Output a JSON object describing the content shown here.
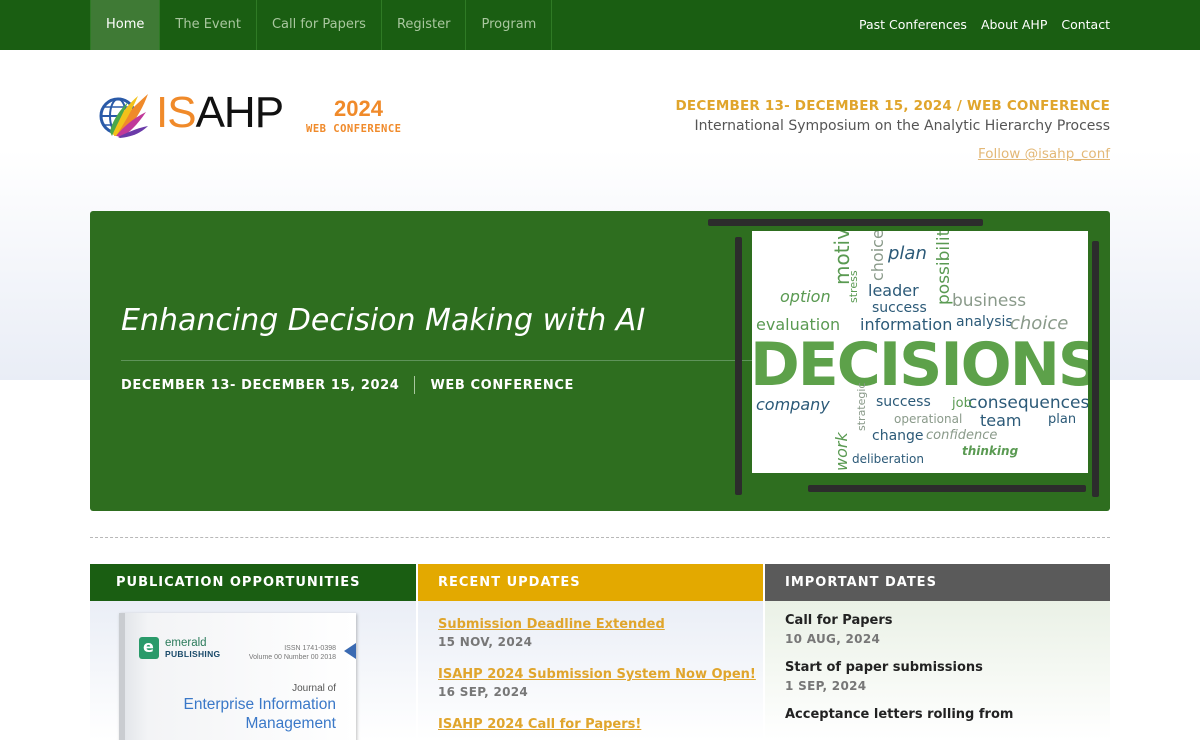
{
  "nav": {
    "items": [
      {
        "label": "Home",
        "active": true
      },
      {
        "label": "The Event"
      },
      {
        "label": "Call for Papers"
      },
      {
        "label": "Register"
      },
      {
        "label": "Program"
      }
    ],
    "right": [
      "Past Conferences",
      "About AHP",
      "Contact"
    ]
  },
  "logo": {
    "is": "IS",
    "ahp": "AHP",
    "year": "2024",
    "sub": "WEB CONFERENCE"
  },
  "header": {
    "dates": "DECEMBER 13- DECEMBER 15, 2024 / WEB CONFERENCE",
    "name": "International Symposium on the Analytic Hierarchy Process",
    "follow": "Follow @isahp_conf"
  },
  "hero": {
    "title": "Enhancing Decision Making with AI",
    "dates": "DECEMBER 13- DECEMBER 15, 2024",
    "format": "WEB CONFERENCE",
    "image_words": {
      "big": "DECISIONS",
      "plan": "plan",
      "possibility": "possibility",
      "business": "business",
      "choice": "choice",
      "option": "option",
      "leader": "leader",
      "success": "success",
      "information": "information",
      "analysis": "analysis",
      "evaluation": "evaluation",
      "confidence": "confidence",
      "stress": "stress",
      "motivation": "motivat",
      "change": "change",
      "company": "company",
      "consequences": "consequences",
      "team": "team",
      "operational": "operational",
      "deliberation": "deliberation",
      "thinking": "thinking",
      "strategic": "strategic",
      "work": "work",
      "job": "job"
    }
  },
  "columns": {
    "publication": {
      "heading": "PUBLICATION OPPORTUNITIES",
      "cover": {
        "publisher_line1": "emerald",
        "publisher_line2": "PUBLISHING",
        "issn": "ISSN 1741-0398",
        "volume": "Volume 00 Number 00 2018",
        "journal_of": "Journal of",
        "title": "Enterprise Information Management"
      }
    },
    "updates": {
      "heading": "RECENT UPDATES",
      "items": [
        {
          "title": "Submission Deadline Extended",
          "date": "15 NOV, 2024"
        },
        {
          "title": "ISAHP 2024 Submission System Now Open!",
          "date": "16 SEP, 2024"
        },
        {
          "title": "ISAHP 2024 Call for Papers!",
          "date": ""
        }
      ]
    },
    "dates": {
      "heading": "IMPORTANT DATES",
      "items": [
        {
          "title": "Call for Papers",
          "date": "10 AUG, 2024"
        },
        {
          "title": "Start of paper submissions",
          "date": "1 SEP, 2024"
        },
        {
          "title": "Acceptance letters rolling from",
          "date": ""
        }
      ]
    }
  },
  "colors": {
    "nav_green": "#1a5e12",
    "hero_green": "#2e6e1f",
    "accent_orange": "#f08a2a",
    "gold": "#e3a900",
    "gray_header": "#5a5a5a"
  }
}
